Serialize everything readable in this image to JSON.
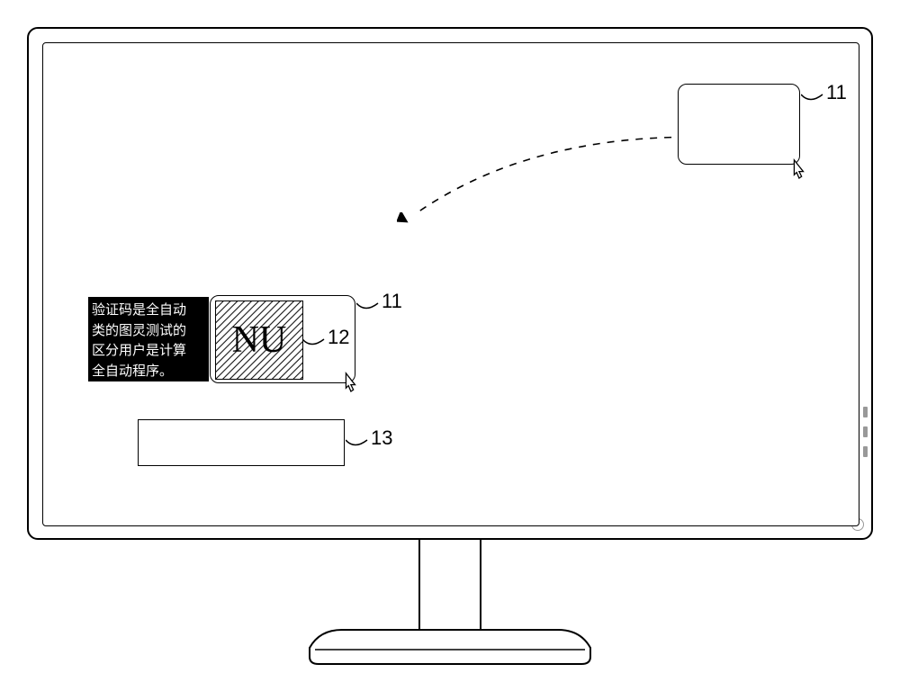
{
  "captcha_text": "NU",
  "tooltip_lines": {
    "l1": "验证码是全自动",
    "l2": "类的图灵测试的",
    "l3": "区分用户是计算",
    "l4": "全自动程序。"
  },
  "labels": {
    "card_top": "11",
    "card_mid": "11",
    "hatched": "12",
    "input": "13"
  }
}
